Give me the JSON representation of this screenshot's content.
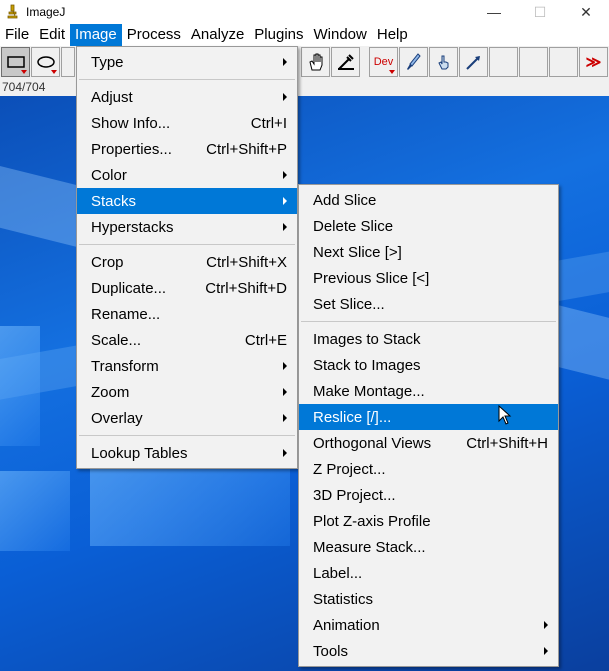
{
  "window": {
    "title": "ImageJ",
    "controls": [
      "—",
      "☐",
      "✕"
    ]
  },
  "menubar": [
    "File",
    "Edit",
    "Image",
    "Process",
    "Analyze",
    "Plugins",
    "Window",
    "Help"
  ],
  "toolbar": {
    "dev_label": "Dev",
    "more_label": "≫"
  },
  "status": "704/704",
  "image_menu": {
    "type": "Type",
    "adjust": "Adjust",
    "show_info": "Show Info...",
    "show_info_sc": "Ctrl+I",
    "properties": "Properties...",
    "properties_sc": "Ctrl+Shift+P",
    "color": "Color",
    "stacks": "Stacks",
    "hyperstacks": "Hyperstacks",
    "crop": "Crop",
    "crop_sc": "Ctrl+Shift+X",
    "duplicate": "Duplicate...",
    "duplicate_sc": "Ctrl+Shift+D",
    "rename": "Rename...",
    "scale": "Scale...",
    "scale_sc": "Ctrl+E",
    "transform": "Transform",
    "zoom": "Zoom",
    "overlay": "Overlay",
    "lookup_tables": "Lookup Tables"
  },
  "stacks_menu": {
    "add_slice": "Add Slice",
    "delete_slice": "Delete Slice",
    "next_slice": "Next Slice [>]",
    "previous_slice": "Previous Slice [<]",
    "set_slice": "Set Slice...",
    "images_to_stack": "Images to Stack",
    "stack_to_images": "Stack to Images",
    "make_montage": "Make Montage...",
    "reslice": "Reslice [/]...",
    "orthogonal_views": "Orthogonal Views",
    "orthogonal_views_sc": "Ctrl+Shift+H",
    "z_project": "Z Project...",
    "three_d_project": "3D Project...",
    "plot_z_axis": "Plot Z-axis Profile",
    "measure_stack": "Measure Stack...",
    "label": "Label...",
    "statistics": "Statistics",
    "animation": "Animation",
    "tools": "Tools"
  },
  "colors": {
    "highlight": "#0078d7",
    "menu_bg": "#f2f2f2",
    "dev_red": "#cc0000"
  },
  "icons": [
    "rectangle-tool-icon",
    "oval-tool-icon",
    "hand-tool-icon",
    "dropper-tool-icon",
    "brush-icon",
    "pointer-hand-icon",
    "arrow-tool-icon"
  ]
}
